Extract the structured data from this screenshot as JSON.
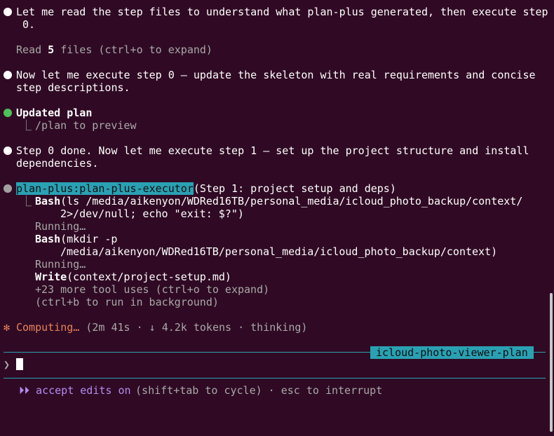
{
  "messages": {
    "m1_l1": "Let me read the step files to understand what plan-plus generated, then execute step",
    "m1_l2": " 0.",
    "read_prefix": "Read ",
    "read_count": "5",
    "read_suffix": " files (ctrl+o to expand)",
    "m2_l1": "Now let me execute step 0 — update the skeleton with real requirements and concise",
    "m2_l2": "step descriptions.",
    "updated_plan": "Updated plan",
    "plan_hint_connector": "⎿",
    "plan_hint": "/plan to preview",
    "m3_l1": "Step 0 done. Now let me execute step 1 — set up the project structure and install",
    "m3_l2": "dependencies.",
    "agent_name": "plan-plus:plan-plus-executor",
    "agent_desc": "(Step 1: project setup and deps)"
  },
  "tools": {
    "bash1_name": "Bash",
    "bash1_l1": "(ls /media/aikenyon/WDRed16TB/personal_media/icloud_photo_backup/context/",
    "bash1_l2": "2>/dev/null; echo \"exit: $?\")",
    "running1": "Running…",
    "bash2_name": "Bash",
    "bash2_l1": "(mkdir -p",
    "bash2_l2": "/media/aikenyon/WDRed16TB/personal_media/icloud_photo_backup/context)",
    "running2": "Running…",
    "write_name": "Write",
    "write_arg": "(context/project-setup.md)",
    "more_uses": "+23 more tool uses (ctrl+o to expand)",
    "background_hint": "(ctrl+b to run in background)"
  },
  "status": {
    "spinner": "✻",
    "computing": "Computing…",
    "stats": " (2m 41s · ↓ 4.2k tokens · thinking)"
  },
  "prompt": {
    "session_tag": "icloud-photo-viewer-plan",
    "prompt_symbol": "❯"
  },
  "footer": {
    "mode_icon": "⏵⏵",
    "mode_text": " accept edits on",
    "mode_hint": " (shift+tab to cycle) · esc to interrupt"
  },
  "colors": {
    "background": "#300a24",
    "accent": "#2aa1b3",
    "success": "#4ec25a",
    "spinner": "#e8825a",
    "mode": "#b38cf0"
  }
}
